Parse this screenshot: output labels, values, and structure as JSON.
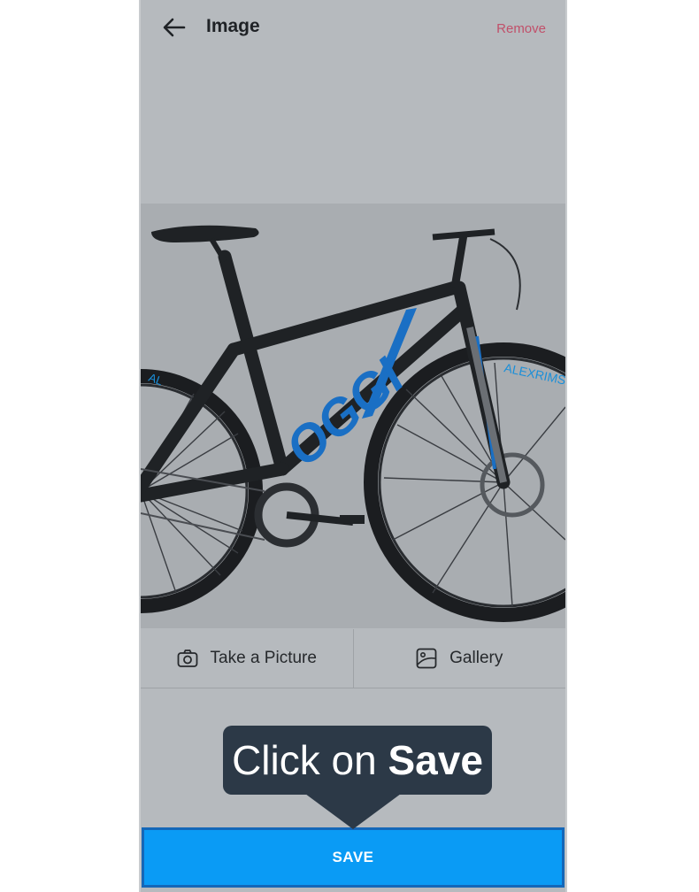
{
  "header": {
    "title": "Image",
    "remove_label": "Remove",
    "back_icon": "arrow-left-icon"
  },
  "image": {
    "description_icon": "bicycle-image",
    "frame_text": "OGGI",
    "tire_text": "ALEXRIMS"
  },
  "actions": {
    "take_picture_label": "Take a Picture",
    "take_picture_icon": "camera-icon",
    "gallery_label": "Gallery",
    "gallery_icon": "image-icon"
  },
  "tooltip": {
    "prefix": "Click on ",
    "emphasis": "Save"
  },
  "save_label": "SAVE",
  "colors": {
    "overlay": "#b6babe",
    "accent_button": "#0a9bf5",
    "remove_text": "#c1506a",
    "tooltip_bg": "#2c3947",
    "bike_accent": "#1a6fc4"
  }
}
